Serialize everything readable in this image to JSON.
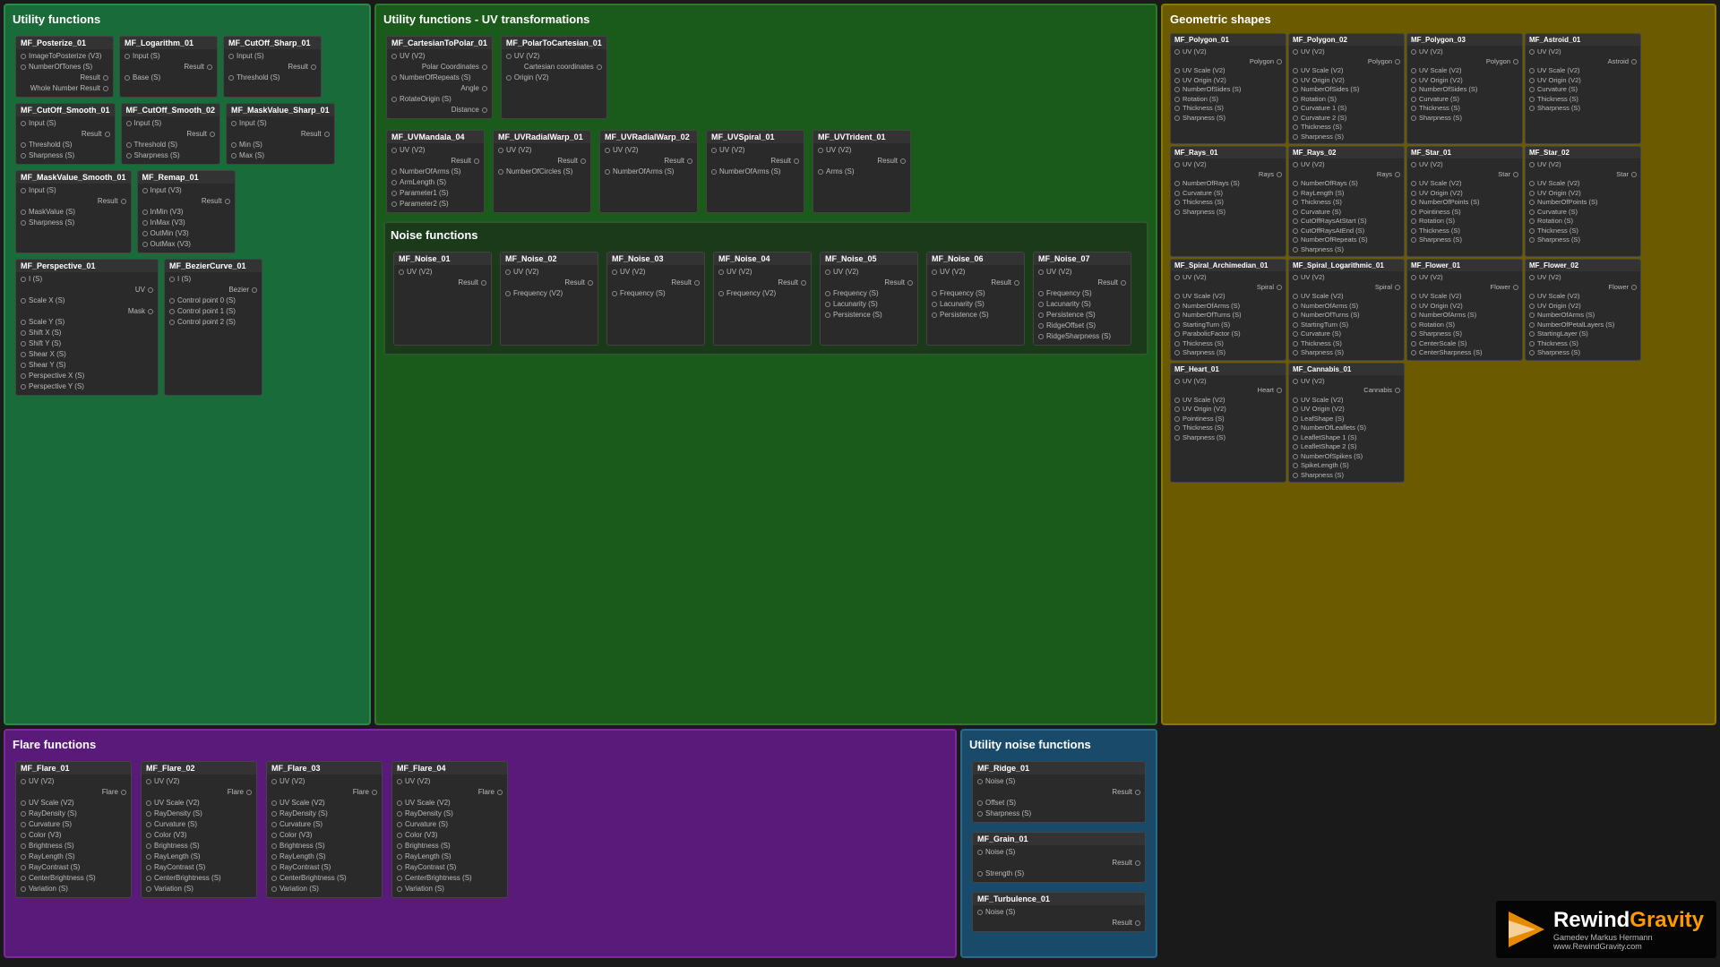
{
  "panels": {
    "utility": {
      "title": "Utility functions",
      "nodes": [
        {
          "id": "MF_Posterize_01",
          "ports_in": [
            "ImageToPosterize (V3)",
            "NumberOfTones (S)"
          ],
          "ports_out": [
            "Result",
            "Whole Number Result"
          ]
        },
        {
          "id": "MF_Logarithm_01",
          "ports_in": [
            "Input (S)",
            "Base (S)"
          ],
          "ports_out": [
            "Result"
          ]
        },
        {
          "id": "MF_CutOff_Sharp_01",
          "ports_in": [
            "Input (S)",
            "Threshold (S)"
          ],
          "ports_out": [
            "Result"
          ]
        },
        {
          "id": "MF_CutOff_Smooth_01",
          "ports_in": [
            "Input (S)",
            "Threshold (S)",
            "Sharpness (S)"
          ],
          "ports_out": [
            "Result"
          ]
        },
        {
          "id": "MF_CutOff_Smooth_02",
          "ports_in": [
            "Input (S)",
            "Threshold (S)",
            "Sharpness (S)"
          ],
          "ports_out": [
            "Result"
          ]
        },
        {
          "id": "MF_MaskValue_Sharp_01",
          "ports_in": [
            "Input (S)",
            "Min (S)",
            "Max (S)"
          ],
          "ports_out": [
            "Result"
          ]
        },
        {
          "id": "MF_MaskValue_Smooth_01",
          "ports_in": [
            "Input (S)",
            "MaskValue (S)",
            "Sharpness (S)"
          ],
          "ports_out": [
            "Result"
          ]
        },
        {
          "id": "MF_Remap_01",
          "ports_in": [
            "Input (V3)",
            "InMin (V3)",
            "InMax (V3)",
            "OutMin (V3)",
            "OutMax (V3)"
          ],
          "ports_out": [
            "Result"
          ]
        },
        {
          "id": "MF_Perspective_01",
          "ports_in": [
            "I (S)",
            "Scale X (S)",
            "Scale Y (S)",
            "Shift X (S)",
            "Shift Y (S)",
            "Shear X (S)",
            "Shear Y (S)",
            "Perspective X (S)",
            "Perspective Y (S)"
          ],
          "ports_out": [
            "UV",
            "Mask"
          ]
        },
        {
          "id": "MF_BezierCurve_01",
          "ports_in": [
            "I (S)",
            "Control point 0 (S)",
            "Control point 1 (S)",
            "Control point 2 (S)"
          ],
          "ports_out": [
            "Bezier"
          ]
        }
      ]
    },
    "uv": {
      "title": "Utility functions - UV transformations",
      "nodes_top": [
        {
          "id": "MF_CartesianToPolar_01",
          "ports_in": [
            "UV (V2)",
            "NumberOfRepeats (S)",
            "RotateOrigin (S)"
          ],
          "ports_out": [
            "Polar Coordinates",
            "Angle",
            "Distance"
          ]
        },
        {
          "id": "MF_PolarToCartesian_01",
          "ports_in": [
            "UV (V2)",
            "Origin (V2)"
          ],
          "ports_out": [
            "Cartesian coordinates"
          ]
        }
      ],
      "nodes_mid": [
        {
          "id": "MF_UVMandala_04",
          "ports_in": [
            "UV (V2)",
            "NumberOfArms (S)",
            "ArmLength (S)",
            "Parameter1 (S)",
            "Parameter2 (S)"
          ],
          "ports_out": [
            "Result"
          ]
        },
        {
          "id": "MF_UVRadialWarp_01",
          "ports_in": [
            "UV (V2)",
            "NumberOfCircles (S)"
          ],
          "ports_out": [
            "Result"
          ]
        },
        {
          "id": "MF_UVRadialWarp_02",
          "ports_in": [
            "UV (V2)",
            "NumberOfArms (S)"
          ],
          "ports_out": [
            "Result"
          ]
        },
        {
          "id": "MF_UVSpiral_01",
          "ports_in": [
            "UV (V2)",
            "NumberOfArms (S)"
          ],
          "ports_out": [
            "Result"
          ]
        },
        {
          "id": "MF_UVTrident_01",
          "ports_in": [
            "UV (V2)",
            "Arms (S)"
          ],
          "ports_out": [
            "Result"
          ]
        }
      ],
      "noise_title": "Noise functions",
      "noise_nodes": [
        {
          "id": "MF_Noise_01",
          "ports_in": [
            "UV (V2)"
          ],
          "ports_out": [
            "Result"
          ]
        },
        {
          "id": "MF_Noise_02",
          "ports_in": [
            "UV (V2)",
            "Frequency (V2)"
          ],
          "ports_out": [
            "Result"
          ]
        },
        {
          "id": "MF_Noise_03",
          "ports_in": [
            "UV (V2)",
            "Frequency (S)"
          ],
          "ports_out": [
            "Result"
          ]
        },
        {
          "id": "MF_Noise_04",
          "ports_in": [
            "UV (V2)",
            "Frequency (V2)"
          ],
          "ports_out": [
            "Result"
          ]
        },
        {
          "id": "MF_Noise_05",
          "ports_in": [
            "UV (V2)",
            "Frequency (S)",
            "Lacunarity (S)",
            "Persistence (S)"
          ],
          "ports_out": [
            "Result"
          ]
        },
        {
          "id": "MF_Noise_06",
          "ports_in": [
            "UV (V2)",
            "Frequency (S)",
            "Lacunarity (S)",
            "Persistence (S)"
          ],
          "ports_out": [
            "Result"
          ]
        },
        {
          "id": "MF_Noise_07",
          "ports_in": [
            "UV (V2)",
            "Frequency (S)",
            "Lacunarity (S)",
            "Persistence (S)",
            "RidgeOffset (S)",
            "RidgeSharpness (S)"
          ],
          "ports_out": [
            "Result"
          ]
        }
      ]
    },
    "geo": {
      "title": "Geometric shapes",
      "nodes": [
        {
          "id": "MF_Polygon_01",
          "ports_in": [
            "UV (V2)",
            "UV Scale (V2)",
            "UV Origin (V2)",
            "NumberOfSides (S)",
            "Rotation (S)",
            "Thickness (S)",
            "Sharpness (S)"
          ],
          "ports_out": [
            "Polygon"
          ]
        },
        {
          "id": "MF_Polygon_02",
          "ports_in": [
            "UV (V2)",
            "UV Scale (V2)",
            "UV Origin (V2)",
            "NumberOfSides (S)",
            "Rotation (S)",
            "Curvature 1 (S)",
            "Curvature 2 (S)",
            "Thickness (S)",
            "Sharpness (S)"
          ],
          "ports_out": [
            "Polygon"
          ]
        },
        {
          "id": "MF_Polygon_03",
          "ports_in": [
            "UV (V2)",
            "UV Scale (V2)",
            "UV Origin (V2)",
            "NumberOfSides (S)",
            "Curvature (S)",
            "Thickness (S)",
            "Sharpness (S)"
          ],
          "ports_out": [
            "Polygon"
          ]
        },
        {
          "id": "MF_Astroid_01",
          "ports_in": [
            "UV (V2)",
            "UV Scale (V2)",
            "UV Origin (V2)",
            "Curvature (S)",
            "Thickness (S)",
            "Sharpness (S)"
          ],
          "ports_out": [
            "Astroid"
          ]
        },
        {
          "id": "MF_Rays_01",
          "ports_in": [
            "UV (V2)",
            "NumberOfRays (S)",
            "Curvature (S)",
            "Thickness (S)",
            "Sharpness (S)"
          ],
          "ports_out": [
            "Rays"
          ]
        },
        {
          "id": "MF_Rays_02",
          "ports_in": [
            "UV (V2)",
            "NumberOfRays (S)",
            "RayLength (S)",
            "Thickness (S)",
            "Curvature (S)",
            "CutOffRaysAtStart (S)",
            "CutOffRaysAtEnd (S)",
            "NumberOfRepeats (S)",
            "Sharpness (S)"
          ],
          "ports_out": [
            "Rays"
          ]
        },
        {
          "id": "MF_Star_01",
          "ports_in": [
            "UV (V2)",
            "UV Scale (V2)",
            "UV Origin (V2)",
            "NumberOfPoints (S)",
            "Pointiness (S)",
            "Rotation (S)",
            "Thickness (S)",
            "Sharpness (S)"
          ],
          "ports_out": [
            "Star"
          ]
        },
        {
          "id": "MF_Star_02",
          "ports_in": [
            "UV (V2)",
            "UV Scale (V2)",
            "UV Origin (V2)",
            "NumberOfPoints (S)",
            "Curvature (S)",
            "Rotation (S)",
            "Thickness (S)",
            "Sharpness (S)"
          ],
          "ports_out": [
            "Star"
          ]
        },
        {
          "id": "MF_Spiral_Archimedian_01",
          "ports_in": [
            "UV (V2)",
            "UV Scale (V2)",
            "NumberOfArms (S)",
            "NumberOfTurns (S)",
            "StartingTurn (S)",
            "ParabolicFactor (S)",
            "Thickness (S)",
            "Sharpness (S)"
          ],
          "ports_out": [
            "Spiral"
          ]
        },
        {
          "id": "MF_Spiral_Logarithmic_01",
          "ports_in": [
            "UV (V2)",
            "UV Scale (V2)",
            "NumberOfArms (S)",
            "NumberOfTurns (S)",
            "StartingTurn (S)",
            "Curvature (S)",
            "Thickness (S)",
            "Sharpness (S)"
          ],
          "ports_out": [
            "Spiral"
          ]
        },
        {
          "id": "MF_Flower_01",
          "ports_in": [
            "UV (V2)",
            "UV Scale (V2)",
            "UV Origin (V2)",
            "NumberOfArms (S)",
            "Rotation (S)",
            "Sharpness (S)",
            "CenterScale (S)",
            "CenterSharpness (S)"
          ],
          "ports_out": [
            "Flower"
          ]
        },
        {
          "id": "MF_Flower_02",
          "ports_in": [
            "UV (V2)",
            "UV Scale (V2)",
            "UV Origin (V2)",
            "NumberOfArms (S)",
            "NumberOfPetalLayers (S)",
            "StartingLayer (S)",
            "Thickness (S)",
            "Sharpness (S)"
          ],
          "ports_out": [
            "Flower"
          ]
        },
        {
          "id": "MF_Heart_01",
          "ports_in": [
            "UV (V2)",
            "UV Scale (V2)",
            "UV Origin (V2)",
            "Pointiness (S)",
            "Thickness (S)",
            "Sharpness (S)"
          ],
          "ports_out": [
            "Heart"
          ]
        },
        {
          "id": "MF_Cannabis_01",
          "ports_in": [
            "UV (V2)",
            "UV Scale (V2)",
            "UV Origin (V2)",
            "LeafShape (S)",
            "NumberOfLeaflets (S)",
            "LeafletShape 1 (S)",
            "LeafletShape 2 (S)",
            "NumberOfSpikes (S)",
            "SpikeLength (S)",
            "Sharpness (S)"
          ],
          "ports_out": [
            "Cannabis"
          ]
        }
      ]
    },
    "flare": {
      "title": "Flare functions",
      "nodes": [
        {
          "id": "MF_Flare_01",
          "ports_in": [
            "UV (V2)",
            "UV Scale (V2)",
            "RayDensity (S)",
            "Curvature (S)",
            "Color (V3)",
            "Brightness (S)",
            "RayLength (S)",
            "RayContrast (S)",
            "CenterBrightness (S)",
            "Variation (S)"
          ],
          "ports_out": [
            "Flare"
          ]
        },
        {
          "id": "MF_Flare_02",
          "ports_in": [
            "UV (V2)",
            "UV Scale (V2)",
            "RayDensity (S)",
            "Curvature (S)",
            "Color (V3)",
            "Brightness (S)",
            "RayLength (S)",
            "RayContrast (S)",
            "CenterBrightness (S)",
            "Variation (S)"
          ],
          "ports_out": [
            "Flare"
          ]
        },
        {
          "id": "MF_Flare_03",
          "ports_in": [
            "UV (V2)",
            "UV Scale (V2)",
            "RayDensity (S)",
            "Curvature (S)",
            "Color (V3)",
            "Brightness (S)",
            "RayLength (S)",
            "RayContrast (S)",
            "CenterBrightness (S)",
            "Variation (S)"
          ],
          "ports_out": [
            "Flare"
          ]
        },
        {
          "id": "MF_Flare_04",
          "ports_in": [
            "UV (V2)",
            "UV Scale (V2)",
            "RayDensity (S)",
            "Curvature (S)",
            "Color (V3)",
            "Brightness (S)",
            "RayLength (S)",
            "RayContrast (S)",
            "CenterBrightness (S)",
            "Variation (S)"
          ],
          "ports_out": [
            "Flare"
          ]
        }
      ]
    },
    "utility_noise": {
      "title": "Utility noise functions",
      "nodes": [
        {
          "id": "MF_Ridge_01",
          "ports_in": [
            "Noise (S)",
            "Offset (S)",
            "Sharpness (S)"
          ],
          "ports_out": [
            "Result"
          ]
        },
        {
          "id": "MF_Grain_01",
          "ports_in": [
            "Noise (S)",
            "Strength (S)"
          ],
          "ports_out": [
            "Result"
          ]
        },
        {
          "id": "MF_Turbulence_01",
          "ports_in": [
            "Noise (S)"
          ],
          "ports_out": [
            "Result"
          ]
        }
      ]
    }
  },
  "logo": {
    "line1_white": "Rewind",
    "line1_orange": "Gravity",
    "line2": "Gamedev Markus Hermann",
    "line3": "www.RewindGravity.com"
  }
}
